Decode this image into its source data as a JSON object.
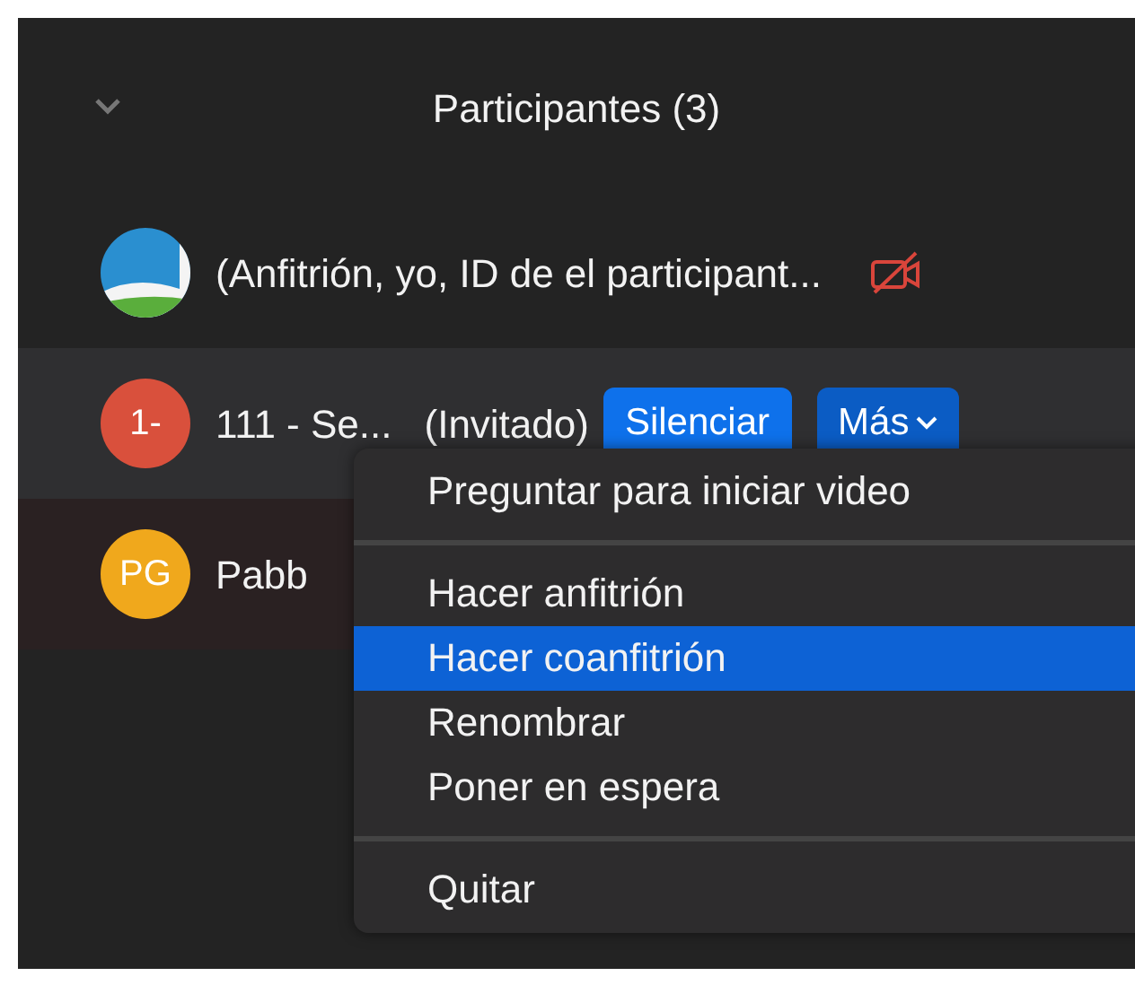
{
  "header": {
    "title": "Participantes (3)"
  },
  "participants": [
    {
      "name": "(Anfitrión, yo, ID de el participant...",
      "video_off": true,
      "hovered": false
    },
    {
      "avatar": {
        "kind": "initials",
        "initials": "1-",
        "color": "#d9503c"
      },
      "name": "111 - Se...",
      "role": "(Invitado)",
      "hovered": true,
      "buttons": [
        {
          "label": "Silenciar",
          "kind": "plain"
        },
        {
          "label": "Más",
          "kind": "dropdown"
        }
      ]
    },
    {
      "avatar": {
        "kind": "initials",
        "initials": "PG",
        "color": "#f0a81c"
      },
      "name": "Pabb",
      "hovered": false
    }
  ],
  "menu": {
    "groups": [
      {
        "items": [
          {
            "label": "Preguntar para iniciar video",
            "selected": false
          }
        ]
      },
      {
        "items": [
          {
            "label": "Hacer anfitrión",
            "selected": false
          },
          {
            "label": "Hacer coanfitrión",
            "selected": true
          },
          {
            "label": "Renombrar",
            "selected": false
          },
          {
            "label": "Poner en espera",
            "selected": false
          }
        ]
      },
      {
        "items": [
          {
            "label": "Quitar",
            "selected": false
          }
        ]
      }
    ]
  }
}
